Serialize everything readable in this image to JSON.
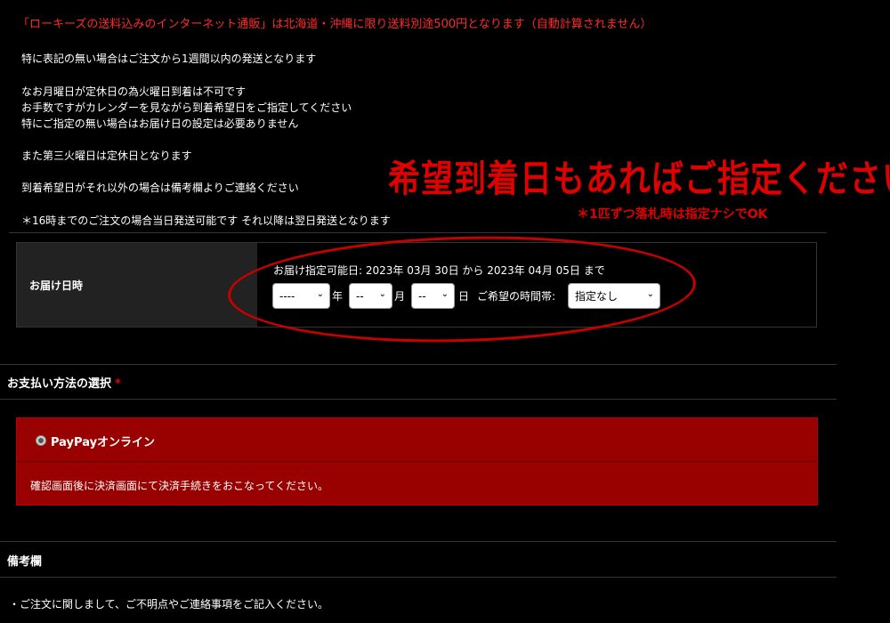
{
  "notice": "「ローキーズの送料込みのインターネット通販」は北海道・沖縄に限り送料別途500円となります（自動計算されません）",
  "info_lines": [
    "特に表記の無い場合はご注文から1週間以内の発送となります",
    "なお月曜日が定休日の為火曜日到着は不可です",
    "お手数ですがカレンダーを見ながら到着希望日をご指定してください",
    "特にご指定の無い場合はお届け日の設定は必要ありません",
    "また第三火曜日は定休日となります",
    "到着希望日がそれ以外の場合は備考欄よりご連絡ください",
    "＊16時までのご注文の場合当日発送可能です それ以降は翌日発送となります"
  ],
  "promo": {
    "headline": "希望到着日もあればご指定ください",
    "subnote": "＊1匹ずつ落札時は指定ナシでOK"
  },
  "delivery": {
    "label": "お届け日時",
    "range_text": "お届け指定可能日: 2023年 03月 30日 から 2023年 04月 05日 まで",
    "year_value": "----",
    "year_unit": "年",
    "month_value": "--",
    "month_unit": "月",
    "day_value": "--",
    "day_unit": "日",
    "time_label": "ご希望の時間帯:",
    "time_value": "指定なし"
  },
  "payment": {
    "title": "お支払い方法の選択",
    "required_mark": "*",
    "option_label": "PayPayオンライン",
    "option_desc": "確認画面後に決済画面にて決済手続きをおこなってください。"
  },
  "remarks": {
    "title": "備考欄",
    "note": "・ご注文に関しまして、ご不明点やご連絡事項をご記入ください。"
  },
  "colors": {
    "background": "#000000",
    "accent_red": "#e00000",
    "payment_box": "#990000"
  },
  "icons": {
    "select_caret": "chevron-down-icon",
    "radio": "radio-button-icon"
  }
}
